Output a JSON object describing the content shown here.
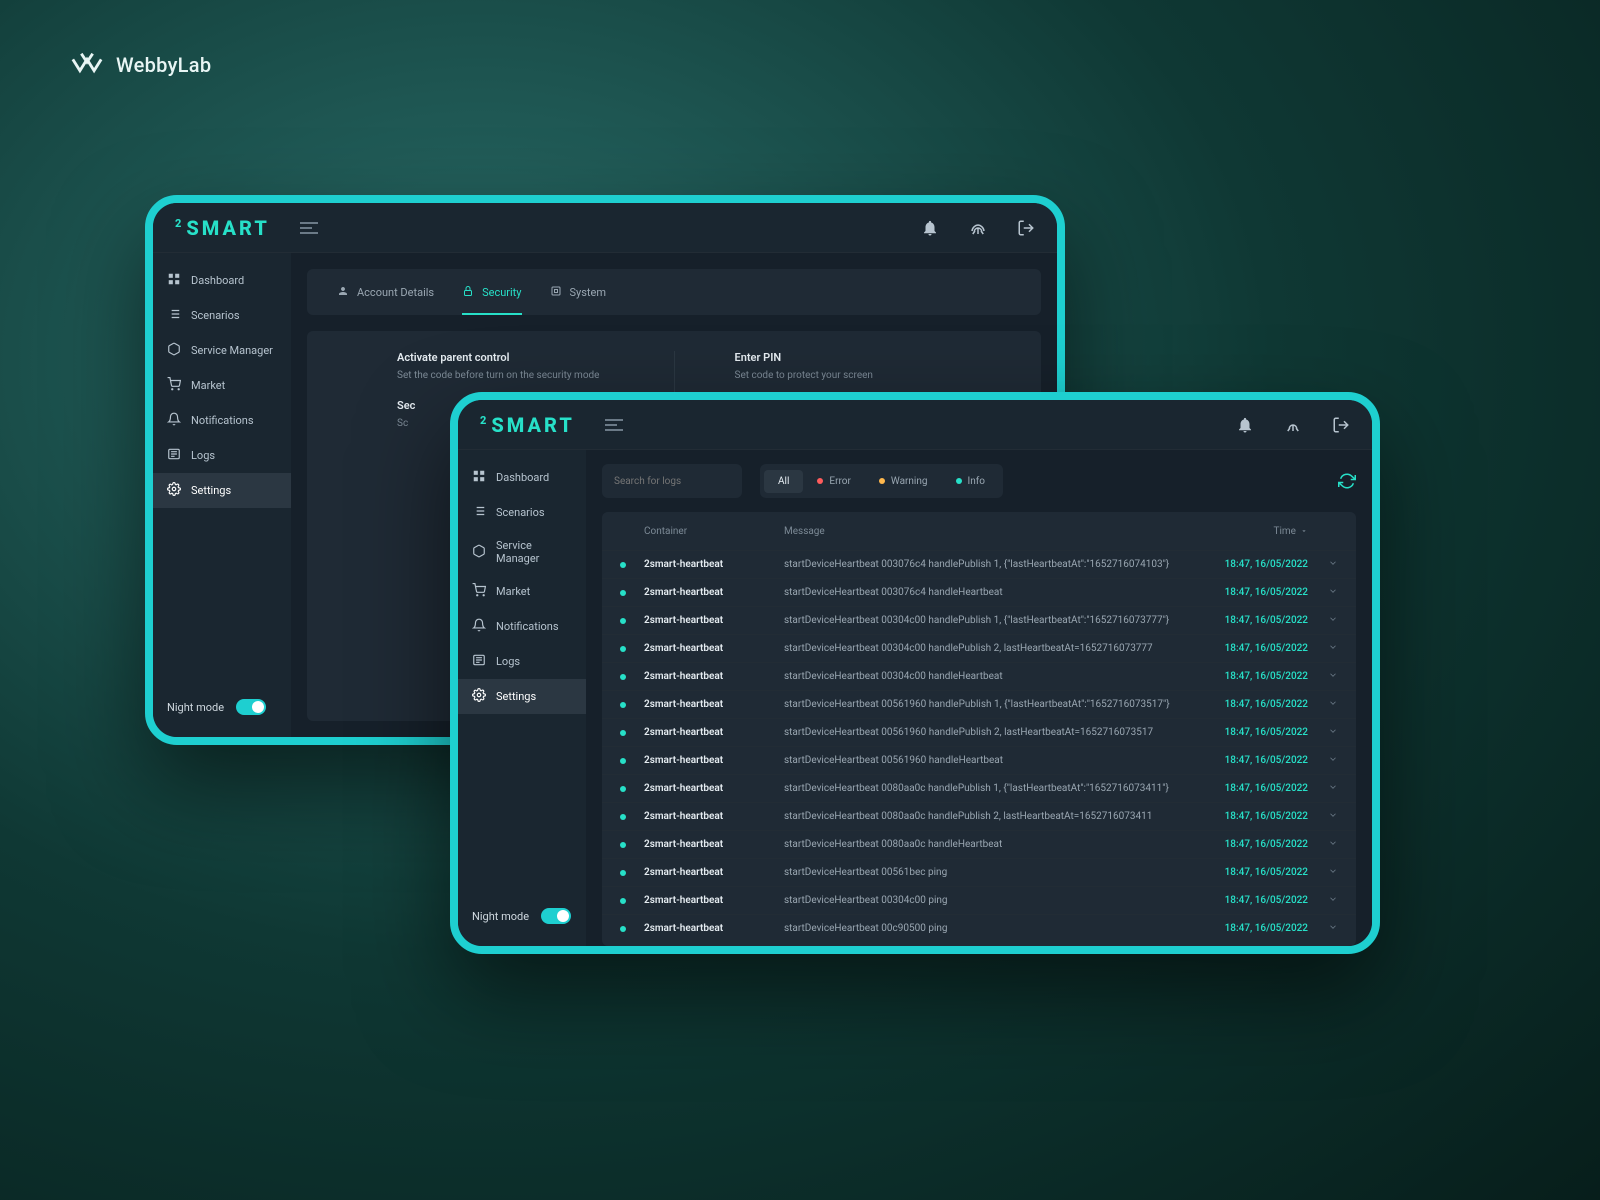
{
  "watermark": "WebbyLab",
  "brand": "SMART",
  "brand_prefix": "2",
  "sidebar": {
    "items": [
      {
        "label": "Dashboard"
      },
      {
        "label": "Scenarios"
      },
      {
        "label": "Service Manager"
      },
      {
        "label": "Market"
      },
      {
        "label": "Notifications"
      },
      {
        "label": "Logs"
      },
      {
        "label": "Settings"
      }
    ],
    "night_mode": "Night mode"
  },
  "settings_view": {
    "active_sidebar_index": 6,
    "tabs": [
      {
        "label": "Account Details"
      },
      {
        "label": "Security"
      },
      {
        "label": "System"
      }
    ],
    "active_tab_index": 1,
    "left": {
      "title": "Activate parent control",
      "sub": "Set the code before turn on the security mode",
      "title2": "Sec",
      "sub2": "Sc"
    },
    "right": {
      "title": "Enter PIN",
      "sub": "Set code to protect your screen"
    }
  },
  "logs_view": {
    "active_sidebar_index": 5,
    "selected_sidebar_index": 6,
    "search_placeholder": "Search for logs",
    "filters": [
      {
        "label": "All",
        "active": true
      },
      {
        "label": "Error",
        "dot": "d-error"
      },
      {
        "label": "Warning",
        "dot": "d-warn"
      },
      {
        "label": "Info",
        "dot": "d-info"
      }
    ],
    "columns": {
      "container": "Container",
      "message": "Message",
      "time": "Time"
    },
    "rows": [
      {
        "container": "2smart-heartbeat",
        "msg": "startDeviceHeartbeat 003076c4 handlePublish 1, {\"lastHeartbeatAt\":\"1652716074103\"}",
        "time": "18:47, 16/05/2022"
      },
      {
        "container": "2smart-heartbeat",
        "msg": "startDeviceHeartbeat 003076c4 handleHeartbeat",
        "time": "18:47, 16/05/2022"
      },
      {
        "container": "2smart-heartbeat",
        "msg": "startDeviceHeartbeat 00304c00 handlePublish 1, {\"lastHeartbeatAt\":\"1652716073777\"}",
        "time": "18:47, 16/05/2022"
      },
      {
        "container": "2smart-heartbeat",
        "msg": "startDeviceHeartbeat 00304c00 handlePublish 2, lastHeartbeatAt=1652716073777",
        "time": "18:47, 16/05/2022"
      },
      {
        "container": "2smart-heartbeat",
        "msg": "startDeviceHeartbeat 00304c00 handleHeartbeat",
        "time": "18:47, 16/05/2022"
      },
      {
        "container": "2smart-heartbeat",
        "msg": "startDeviceHeartbeat 00561960 handlePublish 1, {\"lastHeartbeatAt\":\"1652716073517\"}",
        "time": "18:47, 16/05/2022"
      },
      {
        "container": "2smart-heartbeat",
        "msg": "startDeviceHeartbeat 00561960 handlePublish 2, lastHeartbeatAt=1652716073517",
        "time": "18:47, 16/05/2022"
      },
      {
        "container": "2smart-heartbeat",
        "msg": "startDeviceHeartbeat 00561960 handleHeartbeat",
        "time": "18:47, 16/05/2022"
      },
      {
        "container": "2smart-heartbeat",
        "msg": "startDeviceHeartbeat 0080aa0c handlePublish 1, {\"lastHeartbeatAt\":\"1652716073411\"}",
        "time": "18:47, 16/05/2022"
      },
      {
        "container": "2smart-heartbeat",
        "msg": "startDeviceHeartbeat 0080aa0c handlePublish 2, lastHeartbeatAt=1652716073411",
        "time": "18:47, 16/05/2022"
      },
      {
        "container": "2smart-heartbeat",
        "msg": "startDeviceHeartbeat 0080aa0c handleHeartbeat",
        "time": "18:47, 16/05/2022"
      },
      {
        "container": "2smart-heartbeat",
        "msg": "startDeviceHeartbeat 00561bec ping",
        "time": "18:47, 16/05/2022"
      },
      {
        "container": "2smart-heartbeat",
        "msg": "startDeviceHeartbeat 00304c00 ping",
        "time": "18:47, 16/05/2022"
      },
      {
        "container": "2smart-heartbeat",
        "msg": "startDeviceHeartbeat 00c90500 ping",
        "time": "18:47, 16/05/2022"
      }
    ]
  }
}
